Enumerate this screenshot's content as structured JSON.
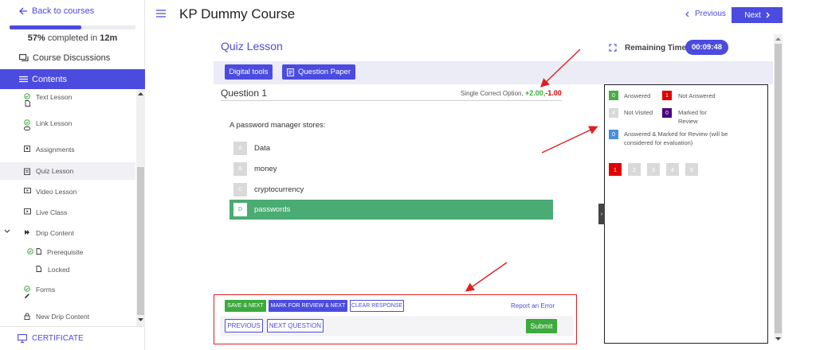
{
  "sidebar": {
    "back_label": "Back to courses",
    "progress_fraction": 0.57,
    "progress_pct": "57%",
    "progress_rest": "completed in",
    "progress_time": "12m",
    "discussions_label": "Course Discussions",
    "contents_label": "Contents",
    "lessons": [
      {
        "label": "Text Lesson"
      },
      {
        "label": "Link Lesson"
      },
      {
        "label": "Assignments"
      },
      {
        "label": "Quiz Lesson"
      },
      {
        "label": "Video Lesson"
      },
      {
        "label": "Live Class"
      },
      {
        "label": "Drip Content"
      },
      {
        "label": "Prerequisite"
      },
      {
        "label": "Locked"
      },
      {
        "label": "Forms"
      },
      {
        "label": "New Drip Content"
      }
    ],
    "certificate_label": "CERTIFICATE"
  },
  "header": {
    "course_title": "KP Dummy Course",
    "previous_label": "Previous",
    "next_label": "Next"
  },
  "quiz": {
    "name": "Quiz Lesson",
    "remaining_label": "Remaining Time:",
    "remaining_value": "00:09:48",
    "digital_tools_label": "Digital tools",
    "question_paper_label": "Question Paper",
    "question_title": "Question 1",
    "question_type": "Single Correct Option,",
    "positive_marks": "+2.00,",
    "negative_marks": "-1.00",
    "question_text": "A password manager stores:",
    "options": [
      {
        "letter": "A",
        "text": "Data"
      },
      {
        "letter": "B",
        "text": "money"
      },
      {
        "letter": "C",
        "text": "cryptocurrency"
      },
      {
        "letter": "D",
        "text": "passwords"
      }
    ],
    "selected_option": "D"
  },
  "actions": {
    "save_next": "SAVE & NEXT",
    "mark_review_next": "MARK FOR REVIEW & NEXT",
    "clear_response": "CLEAR RESPONSE",
    "report_error": "Report an Error",
    "previous": "PREVIOUS",
    "next_question": "NEXT QUESTION",
    "submit": "Submit"
  },
  "palette": {
    "legend": [
      {
        "count": "0",
        "label": "Answered",
        "color": "#4aac4a"
      },
      {
        "count": "1",
        "label": "Not Answered",
        "color": "#e00000"
      },
      {
        "count": "4",
        "label": "Not Visited",
        "color": "#d9d9d9"
      },
      {
        "count": "0",
        "label": "Marked for Review",
        "color": "#4b0082"
      },
      {
        "count": "0",
        "label": "Answered & Marked for Review (will be considered for evaluation)",
        "color": "#4a90d9"
      }
    ],
    "questions": [
      "1",
      "2",
      "3",
      "4",
      "5"
    ],
    "current_question": "1"
  },
  "colors": {
    "accent": "#4b4be0",
    "selected_option": "#4aac73",
    "annotation": "#e02020"
  }
}
